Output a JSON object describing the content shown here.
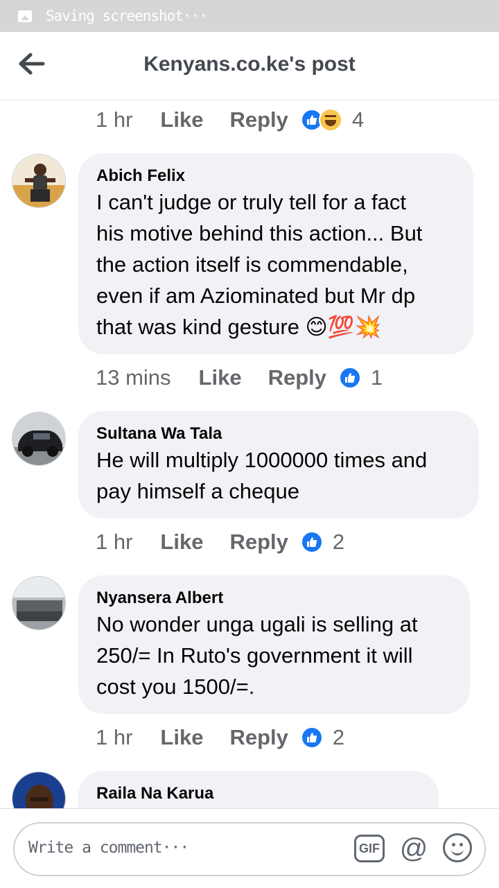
{
  "status_bar": {
    "text": "Saving screenshot···"
  },
  "header": {
    "title": "Kenyans.co.ke's post"
  },
  "comments": [
    {
      "time": "1 hr",
      "like": "Like",
      "reply": "Reply",
      "reaction_count": "4",
      "reactions": [
        "like-icon",
        "haha-icon"
      ]
    },
    {
      "name": "Abich Felix",
      "lines": [
        "I can't judge or truly tell for a fact",
        "his motive behind this action... But",
        "the action itself is commendable,",
        "even if am Aziominated but Mr dp",
        "that was kind gesture 😊💯💥"
      ],
      "time": "13 mins",
      "like": "Like",
      "reply": "Reply",
      "reaction_count": "1"
    },
    {
      "name": "Sultana Wa Tala",
      "lines": [
        "He will multiply 1000000 times and",
        "pay himself a cheque"
      ],
      "time": "1 hr",
      "like": "Like",
      "reply": "Reply",
      "reaction_count": "2"
    },
    {
      "name": "Nyansera Albert",
      "lines": [
        "No  wonder unga ugali is selling at",
        "250/= In Ruto's government it will",
        "cost you 1500/=."
      ],
      "time": "1 hr",
      "like": "Like",
      "reply": "Reply",
      "reaction_count": "2"
    },
    {
      "name": "Raila Na Karua"
    }
  ],
  "composer": {
    "placeholder": "Write a comment···",
    "gif_label": "GIF",
    "at_label": "@"
  },
  "colors": {
    "like_blue": "#1877f2",
    "bubble_bg": "#f0f2f5",
    "meta_gray": "#65676b"
  }
}
